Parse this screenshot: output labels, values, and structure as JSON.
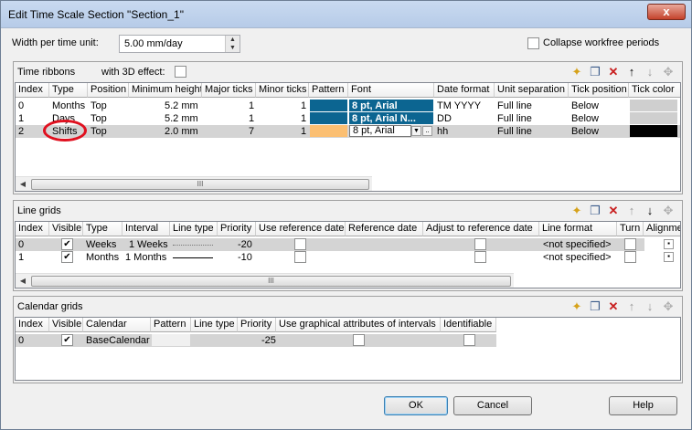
{
  "window": {
    "title": "Edit Time Scale Section \"Section_1\"",
    "close": "x"
  },
  "width_per_time_unit": {
    "label": "Width per time unit:",
    "value": "5.00 mm/day"
  },
  "collapse": {
    "label": "Collapse workfree periods",
    "checked": false
  },
  "time_ribbons": {
    "title": "Time ribbons",
    "effect_label": "with 3D effect:",
    "columns": [
      "Index",
      "Type",
      "Position",
      "Minimum height",
      "Major ticks",
      "Minor ticks",
      "Pattern",
      "Font",
      "Date format",
      "Unit separation",
      "Tick position",
      "Tick color"
    ],
    "rows": [
      {
        "index": "0",
        "type": "Months",
        "position": "Top",
        "min_height": "5.2 mm",
        "major": "1",
        "minor": "1",
        "font": "8 pt, Arial",
        "date_format": "TM YYYY",
        "unit_sep": "Full line",
        "tick_pos": "Below"
      },
      {
        "index": "1",
        "type": "Days",
        "position": "Top",
        "min_height": "5.2 mm",
        "major": "1",
        "minor": "1",
        "font": "8 pt, Arial N...",
        "date_format": "DD",
        "unit_sep": "Full line",
        "tick_pos": "Below"
      },
      {
        "index": "2",
        "type": "Shifts",
        "position": "Top",
        "min_height": "2.0 mm",
        "major": "7",
        "minor": "1",
        "font": "8 pt, Arial",
        "date_format": "hh",
        "unit_sep": "Full line",
        "tick_pos": "Below"
      }
    ],
    "scroll_grip": "III"
  },
  "line_grids": {
    "title": "Line grids",
    "columns": [
      "Index",
      "Visible",
      "Type",
      "Interval",
      "Line type",
      "Priority",
      "Use reference date",
      "Reference date",
      "Adjust to reference date",
      "Line format",
      "Turn",
      "Alignme"
    ],
    "rows": [
      {
        "index": "0",
        "type": "Weeks",
        "interval": "1 Weeks",
        "priority": "-20",
        "line_format": "<not specified>"
      },
      {
        "index": "1",
        "type": "Months",
        "interval": "1 Months",
        "priority": "-10",
        "line_format": "<not specified>"
      }
    ],
    "scroll_grip": "III"
  },
  "calendar_grids": {
    "title": "Calendar grids",
    "columns": [
      "Index",
      "Visible",
      "Calendar",
      "Pattern",
      "Line type",
      "Priority",
      "Use graphical attributes of intervals",
      "Identifiable"
    ],
    "rows": [
      {
        "index": "0",
        "calendar": "BaseCalendar",
        "priority": "-25"
      }
    ]
  },
  "buttons": {
    "ok": "OK",
    "cancel": "Cancel",
    "help": "Help"
  },
  "colors": {
    "font_cell": "#0c6591",
    "pattern_orange": "#fbbf72",
    "annotation": "#e0101f"
  }
}
